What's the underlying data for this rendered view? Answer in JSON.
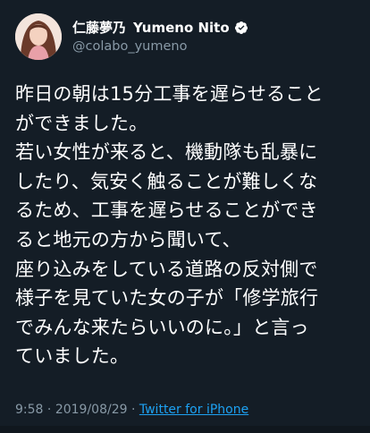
{
  "user": {
    "display_name": "仁藤夢乃",
    "display_name_latin": "Yumeno Nito",
    "handle": "@colabo_yumeno",
    "avatar_icon": "profile-photo",
    "verified_icon": "verified-badge-icon"
  },
  "tweet": {
    "lines": [
      "昨日の朝は15分工事を遅らせること",
      "ができました。",
      "若い女性が来ると、機動隊も乱暴に",
      "したり、気安く触ることが難しくな",
      "るため、工事を遅らせることができ",
      "ると地元の方から聞いて、",
      "座り込みをしている道路の反対側で",
      "様子を見ていた女の子が「修学旅行",
      "でみんな来たらいいのに。」と言っ",
      "ていました。"
    ]
  },
  "meta": {
    "time": "9:58",
    "separator": "·",
    "date": "2019/08/29",
    "separator2": "·",
    "source": "Twitter for iPhone"
  },
  "colors": {
    "background": "#141d26",
    "text": "#ffffff",
    "muted": "#8899a6",
    "link": "#1da1f2"
  }
}
